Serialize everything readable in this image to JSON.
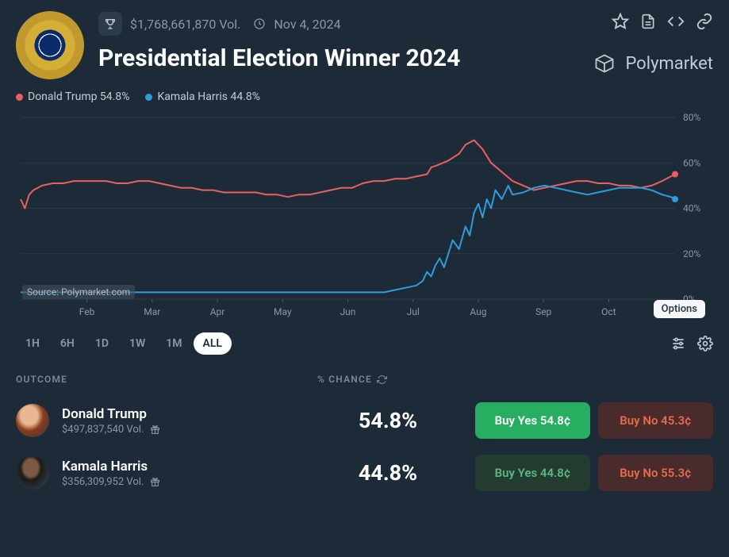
{
  "header": {
    "volume": "$1,768,661,870 Vol.",
    "date": "Nov 4, 2024",
    "title": "Presidential Election Winner 2024",
    "brand": "Polymarket"
  },
  "legend": {
    "s1_label": "Donald Trump 54.8%",
    "s2_label": "Kamala Harris 44.8%"
  },
  "colors": {
    "s1": "#e8605f",
    "s2": "#2d9cdb"
  },
  "source_tag": "Source: Polymarket.com",
  "options_tag": "Options",
  "ranges": [
    "1H",
    "6H",
    "1D",
    "1W",
    "1M",
    "ALL"
  ],
  "range_active": "ALL",
  "table": {
    "h_outcome": "OUTCOME",
    "h_chance": "% CHANCE"
  },
  "outcomes": [
    {
      "name": "Donald Trump",
      "vol": "$497,837,540 Vol.",
      "chance": "54.8%",
      "yes": "Buy Yes 54.8¢",
      "no": "Buy No 45.3¢"
    },
    {
      "name": "Kamala Harris",
      "vol": "$356,309,952 Vol.",
      "chance": "44.8%",
      "yes": "Buy Yes 44.8¢",
      "no": "Buy No 55.3¢"
    }
  ],
  "chart_data": {
    "type": "line",
    "title": "Presidential Election Winner 2024",
    "xlabel": "",
    "ylabel": "",
    "ylim": [
      0,
      80
    ],
    "y_ticks": [
      0,
      20,
      40,
      60,
      80
    ],
    "y_tick_labels": [
      "0%",
      "20%",
      "40%",
      "60%",
      "80%"
    ],
    "categories": [
      "Feb",
      "Mar",
      "Apr",
      "May",
      "Jun",
      "Jul",
      "Aug",
      "Sep",
      "Oct"
    ],
    "xlim": [
      10,
      316
    ],
    "series": [
      {
        "name": "Donald Trump",
        "color": "#e8605f",
        "x": [
          10,
          12,
          14,
          16,
          18,
          20,
          25,
          30,
          35,
          40,
          45,
          50,
          55,
          60,
          65,
          70,
          75,
          80,
          85,
          90,
          95,
          100,
          105,
          110,
          115,
          120,
          125,
          130,
          135,
          140,
          145,
          150,
          155,
          160,
          165,
          170,
          175,
          180,
          185,
          190,
          195,
          200,
          202,
          205,
          210,
          215,
          218,
          222,
          226,
          230,
          235,
          240,
          245,
          250,
          255,
          260,
          265,
          270,
          275,
          280,
          285,
          290,
          295,
          300,
          305,
          310,
          314,
          316
        ],
        "values": [
          44,
          40,
          46,
          48,
          49,
          50,
          51,
          51,
          52,
          52,
          52,
          52,
          51,
          51,
          52,
          52,
          51,
          50,
          49,
          49,
          48,
          48,
          47,
          47,
          47,
          47,
          46,
          46,
          45,
          46,
          46,
          47,
          48,
          49,
          49,
          51,
          52,
          52,
          53,
          53,
          54,
          55,
          58,
          59,
          61,
          64,
          68,
          70,
          66,
          60,
          56,
          52,
          50,
          48,
          49,
          50,
          51,
          52,
          52,
          51,
          51,
          50,
          50,
          49,
          50,
          52,
          54,
          55
        ]
      },
      {
        "name": "Kamala Harris",
        "color": "#2d9cdb",
        "x": [
          10,
          30,
          60,
          90,
          120,
          150,
          170,
          180,
          185,
          190,
          195,
          198,
          200,
          202,
          204,
          206,
          208,
          210,
          212,
          215,
          218,
          220,
          222,
          224,
          226,
          228,
          230,
          232,
          235,
          238,
          240,
          245,
          250,
          255,
          260,
          265,
          270,
          275,
          280,
          285,
          290,
          295,
          300,
          305,
          310,
          314,
          316
        ],
        "values": [
          3,
          3,
          3,
          3,
          3,
          3,
          3,
          3,
          4,
          5,
          6,
          8,
          12,
          10,
          15,
          18,
          14,
          20,
          26,
          22,
          32,
          28,
          38,
          42,
          36,
          44,
          40,
          48,
          44,
          50,
          46,
          47,
          49,
          50,
          49,
          48,
          47,
          46,
          47,
          48,
          49,
          49,
          49,
          48,
          46,
          45,
          44
        ]
      }
    ]
  }
}
